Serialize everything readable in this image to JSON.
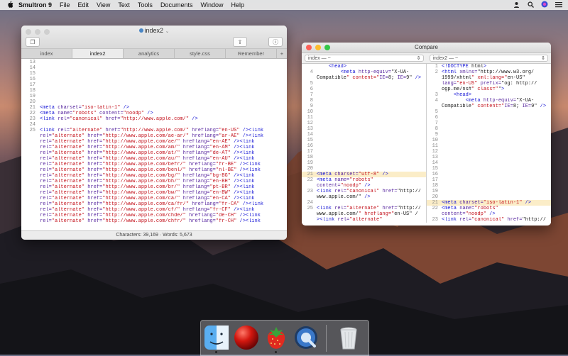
{
  "menubar": {
    "apple": "",
    "app": "Smultron 9",
    "items": [
      "File",
      "Edit",
      "View",
      "Text",
      "Tools",
      "Documents",
      "Window",
      "Help"
    ]
  },
  "editor_window": {
    "title": "index2",
    "tabs": [
      "index",
      "index2",
      "analytics",
      "style.css",
      "Remember",
      "+"
    ],
    "lines": [
      {
        "n": "13",
        "t": ""
      },
      {
        "n": "14",
        "t": ""
      },
      {
        "n": "15",
        "t": ""
      },
      {
        "n": "16",
        "t": ""
      },
      {
        "n": "17",
        "t": ""
      },
      {
        "n": "18",
        "t": ""
      },
      {
        "n": "19",
        "t": ""
      },
      {
        "n": "20",
        "t": ""
      },
      {
        "n": "21",
        "t": "<meta charset=\"iso-latin-1\" />"
      },
      {
        "n": "22",
        "t": "<meta name=\"robots\" content=\"noodp\" />"
      },
      {
        "n": "23",
        "t": "<link rel=\"canonical\" href=\"http://www.apple.com/\" />"
      },
      {
        "n": "24",
        "t": ""
      },
      {
        "n": "25",
        "t": "<link rel=\"alternate\" href=\"http://www.apple.com/\" hreflang=\"en-US\" /><link"
      },
      {
        "n": "",
        "t": "rel=\"alternate\" href=\"http://www.apple.com/ae-ar/\" hreflang=\"ar-AE\" /><link"
      },
      {
        "n": "",
        "t": "rel=\"alternate\" href=\"http://www.apple.com/ae/\" hreflang=\"en-AE\" /><link"
      },
      {
        "n": "",
        "t": "rel=\"alternate\" href=\"http://www.apple.com/am/\" hreflang=\"en-AM\" /><link"
      },
      {
        "n": "",
        "t": "rel=\"alternate\" href=\"http://www.apple.com/at/\" hreflang=\"de-AT\" /><link"
      },
      {
        "n": "",
        "t": "rel=\"alternate\" href=\"http://www.apple.com/au/\" hreflang=\"en-AU\" /><link"
      },
      {
        "n": "",
        "t": "rel=\"alternate\" href=\"http://www.apple.com/befr/\" hreflang=\"fr-BE\" /><link"
      },
      {
        "n": "",
        "t": "rel=\"alternate\" href=\"http://www.apple.com/benl/\" hreflang=\"nl-BE\" /><link"
      },
      {
        "n": "",
        "t": "rel=\"alternate\" href=\"http://www.apple.com/bg/\" hreflang=\"bg-BG\" /><link"
      },
      {
        "n": "",
        "t": "rel=\"alternate\" href=\"http://www.apple.com/bh/\" hreflang=\"en-BH\" /><link"
      },
      {
        "n": "",
        "t": "rel=\"alternate\" href=\"http://www.apple.com/br/\" hreflang=\"pt-BR\" /><link"
      },
      {
        "n": "",
        "t": "rel=\"alternate\" href=\"http://www.apple.com/bw/\" hreflang=\"en-BW\" /><link"
      },
      {
        "n": "",
        "t": "rel=\"alternate\" href=\"http://www.apple.com/ca/\" hreflang=\"en-CA\" /><link"
      },
      {
        "n": "",
        "t": "rel=\"alternate\" href=\"http://www.apple.com/ca/fr/\" hreflang=\"fr-CA\" /><link"
      },
      {
        "n": "",
        "t": "rel=\"alternate\" href=\"http://www.apple.com/cf/\" hreflang=\"fr-CF\" /><link"
      },
      {
        "n": "",
        "t": "rel=\"alternate\" href=\"http://www.apple.com/chde/\" hreflang=\"de-CH\" /><link"
      },
      {
        "n": "",
        "t": "rel=\"alternate\" href=\"http://www.apple.com/chfr/\" hreflang=\"fr-CH\" /><link"
      }
    ],
    "status": "Characters: 39,169  ·  Words: 5,673"
  },
  "compare_window": {
    "title": "Compare",
    "left_select": "index — ~",
    "right_select": "index2 — ~",
    "left_lines": [
      {
        "n": "",
        "t": "    <head>",
        "hl": false
      },
      {
        "n": "4",
        "t": "        <meta http-equiv=\"X-UA-",
        "hl": false
      },
      {
        "n": "",
        "t": "Compatible\" content=\"IE=8; IE=9\" />",
        "hl": false
      },
      {
        "n": "5",
        "t": "",
        "hl": false
      },
      {
        "n": "6",
        "t": "",
        "hl": false
      },
      {
        "n": "7",
        "t": "",
        "hl": false
      },
      {
        "n": "8",
        "t": "",
        "hl": false
      },
      {
        "n": "9",
        "t": "",
        "hl": false
      },
      {
        "n": "10",
        "t": "",
        "hl": false
      },
      {
        "n": "11",
        "t": "",
        "hl": false
      },
      {
        "n": "12",
        "t": "",
        "hl": false
      },
      {
        "n": "13",
        "t": "",
        "hl": false
      },
      {
        "n": "14",
        "t": "",
        "hl": false
      },
      {
        "n": "15",
        "t": "",
        "hl": false
      },
      {
        "n": "16",
        "t": "",
        "hl": false
      },
      {
        "n": "17",
        "t": "",
        "hl": false
      },
      {
        "n": "18",
        "t": "",
        "hl": false
      },
      {
        "n": "19",
        "t": "",
        "hl": false
      },
      {
        "n": "20",
        "t": "",
        "hl": false
      },
      {
        "n": "21",
        "t": "<meta charset=\"utf-8\" />",
        "hl": true
      },
      {
        "n": "22",
        "t": "<meta name=\"robots\"",
        "hl": false
      },
      {
        "n": "",
        "t": "content=\"noodp\" />",
        "hl": false
      },
      {
        "n": "23",
        "t": "<link rel=\"canonical\" href=\"http://",
        "hl": false
      },
      {
        "n": "",
        "t": "www.apple.com/\" />",
        "hl": false
      },
      {
        "n": "24",
        "t": "",
        "hl": false
      },
      {
        "n": "25",
        "t": "<link rel=\"alternate\" href=\"http://",
        "hl": false
      },
      {
        "n": "",
        "t": "www.apple.com/\" hreflang=\"en-US\" /",
        "hl": false
      },
      {
        "n": "",
        "t": "><link rel=\"alternate\"",
        "hl": false
      }
    ],
    "right_lines": [
      {
        "n": "1",
        "t": "<!DOCTYPE html>",
        "hl": false
      },
      {
        "n": "2",
        "t": "<html xmlns=\"http://www.w3.org/",
        "hl": false
      },
      {
        "n": "",
        "t": "1999/xhtml\" xml:lang=\"en-US\"",
        "hl": false
      },
      {
        "n": "",
        "t": "lang=\"en-US\" prefix=\"og: http://",
        "hl": false
      },
      {
        "n": "",
        "t": "ogp.me/ns#\" class=\"\">",
        "hl": false
      },
      {
        "n": "3",
        "t": "    <head>",
        "hl": false
      },
      {
        "n": "4",
        "t": "        <meta http-equiv=\"X-UA-",
        "hl": false
      },
      {
        "n": "",
        "t": "Compatible\" content=\"IE=8; IE=9\" />",
        "hl": false
      },
      {
        "n": "5",
        "t": "",
        "hl": false
      },
      {
        "n": "6",
        "t": "",
        "hl": false
      },
      {
        "n": "7",
        "t": "",
        "hl": false
      },
      {
        "n": "8",
        "t": "",
        "hl": false
      },
      {
        "n": "9",
        "t": "",
        "hl": false
      },
      {
        "n": "10",
        "t": "",
        "hl": false
      },
      {
        "n": "11",
        "t": "",
        "hl": false
      },
      {
        "n": "12",
        "t": "",
        "hl": false
      },
      {
        "n": "13",
        "t": "",
        "hl": false
      },
      {
        "n": "14",
        "t": "",
        "hl": false
      },
      {
        "n": "15",
        "t": "",
        "hl": false
      },
      {
        "n": "16",
        "t": "",
        "hl": false
      },
      {
        "n": "17",
        "t": "",
        "hl": false
      },
      {
        "n": "18",
        "t": "",
        "hl": false
      },
      {
        "n": "19",
        "t": "",
        "hl": false
      },
      {
        "n": "20",
        "t": "",
        "hl": false
      },
      {
        "n": "21",
        "t": "<meta charset=\"iso-latin-1\" />",
        "hl": true
      },
      {
        "n": "22",
        "t": "<meta name=\"robots\"",
        "hl": false
      },
      {
        "n": "",
        "t": "content=\"noodp\" />",
        "hl": false
      },
      {
        "n": "23",
        "t": "<link rel=\"canonical\" href=\"http://",
        "hl": false
      }
    ]
  },
  "dock": {
    "apps": [
      {
        "name": "finder-icon",
        "running": true
      },
      {
        "name": "red-ball-app-icon",
        "running": false
      },
      {
        "name": "smultron-icon",
        "running": true
      },
      {
        "name": "quicktime-icon",
        "running": false
      },
      {
        "name": "trash-icon",
        "running": false
      }
    ]
  },
  "colors": {
    "keyword": "#1a1ad6",
    "string": "#c4141e",
    "highlight": "#fbedc8",
    "close": "#fc5f57",
    "minimize": "#fdbc2e",
    "zoom": "#33c748"
  }
}
